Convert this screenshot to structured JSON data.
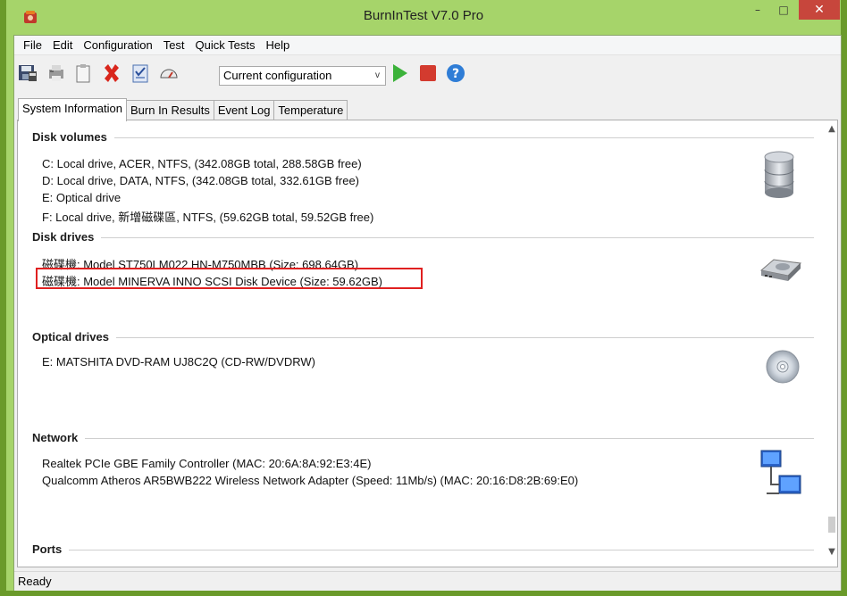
{
  "window": {
    "title": "BurnInTest V7.0 Pro",
    "minimize_label": "–",
    "maximize_label": "□",
    "close_label": "✕"
  },
  "menu": [
    "File",
    "Edit",
    "Configuration",
    "Test",
    "Quick Tests",
    "Help"
  ],
  "toolbar": {
    "icons": [
      "save-icon",
      "print-icon",
      "clipboard-icon",
      "delete-icon",
      "checklist-icon",
      "gauge-icon"
    ],
    "config_select": "Current configuration",
    "start_icon": "play-icon",
    "stop_icon": "stop-icon",
    "help_icon": "help-icon"
  },
  "tabs": [
    "System Information",
    "Burn In Results",
    "Event Log",
    "Temperature"
  ],
  "active_tab": 0,
  "sections": {
    "disk_volumes": {
      "title": "Disk volumes",
      "lines": [
        "C:  Local drive, ACER, NTFS, (342.08GB total, 288.58GB free)",
        "D:  Local drive, DATA, NTFS, (342.08GB total, 332.61GB free)",
        "E:  Optical drive",
        "F:  Local drive, 新增磁碟區, NTFS, (59.62GB total, 59.52GB free)"
      ]
    },
    "disk_drives": {
      "title": "Disk drives",
      "lines": [
        "磁碟機: Model ST750LM022 HN-M750MBB (Size: 698.64GB)",
        "磁碟機: Model MINERVA INNO SCSI Disk Device (Size: 59.62GB)"
      ]
    },
    "optical_drives": {
      "title": "Optical drives",
      "lines": [
        "E: MATSHITA DVD-RAM UJ8C2Q (CD-RW/DVDRW)"
      ]
    },
    "network": {
      "title": "Network",
      "lines": [
        "Realtek PCIe GBE Family Controller (MAC: 20:6A:8A:92:E3:4E)",
        "Qualcomm Atheros AR5BWB222 Wireless Network Adapter (Speed: 11Mb/s) (MAC: 20:16:D8:2B:69:E0)"
      ]
    },
    "ports": {
      "title": "Ports"
    }
  },
  "status": "Ready",
  "colors": {
    "frame": "#a6d46a",
    "highlight": "#e02020",
    "close": "#c7463c"
  }
}
